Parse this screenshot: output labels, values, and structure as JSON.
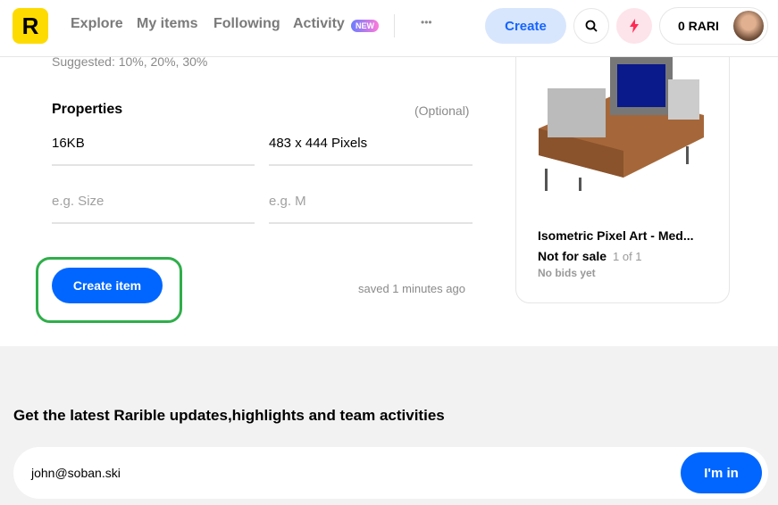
{
  "header": {
    "logo": "R",
    "nav": [
      {
        "label": "Explore"
      },
      {
        "label": "My items"
      },
      {
        "label": "Following"
      },
      {
        "label": "Activity",
        "badge": "NEW"
      }
    ],
    "more": "•••",
    "create_label": "Create",
    "balance": "0 RARI",
    "colors": {
      "accent": "#1565ff",
      "logo": "#fedb00"
    }
  },
  "form": {
    "suggested": "Suggested: 10%, 20%, 30%",
    "properties_title": "Properties",
    "optional": "(Optional)",
    "fields": [
      {
        "value": "16KB"
      },
      {
        "value": "483 x 444 Pixels"
      },
      {
        "placeholder": "e.g. Size"
      },
      {
        "placeholder": "e.g. M"
      }
    ],
    "create_item": "Create item",
    "saved": "saved 1 minutes ago"
  },
  "preview": {
    "title": "Isometric Pixel Art - Med...",
    "status": "Not for sale",
    "edition": "1 of 1",
    "bids": "No bids yet"
  },
  "footer": {
    "headline": "Get the latest Rarible updates,highlights and team activities",
    "email": "john@soban.ski",
    "submit": "I'm in"
  }
}
